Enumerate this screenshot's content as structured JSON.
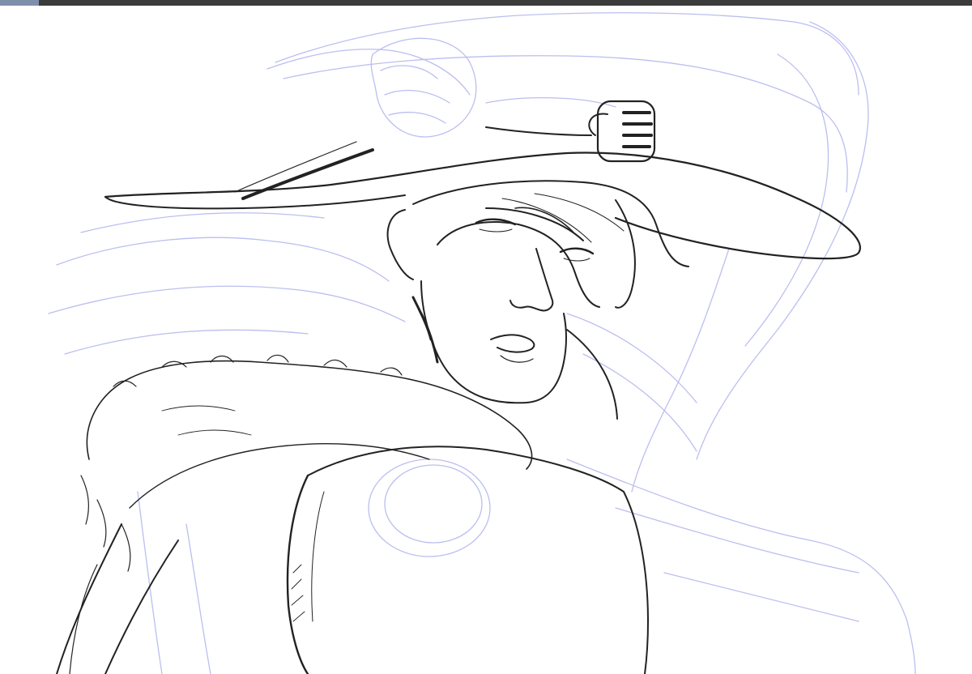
{
  "window": {
    "chrome_color": "#3b3b3b",
    "active_tab_color": "#7f8fab"
  },
  "canvas": {
    "background_color": "#ffffff",
    "layers": [
      {
        "kind": "rough-sketch",
        "color": "#b4b8ee"
      },
      {
        "kind": "line-art",
        "color": "#222222"
      }
    ]
  },
  "icons": {
    "canvas": "artwork-canvas-icon"
  }
}
